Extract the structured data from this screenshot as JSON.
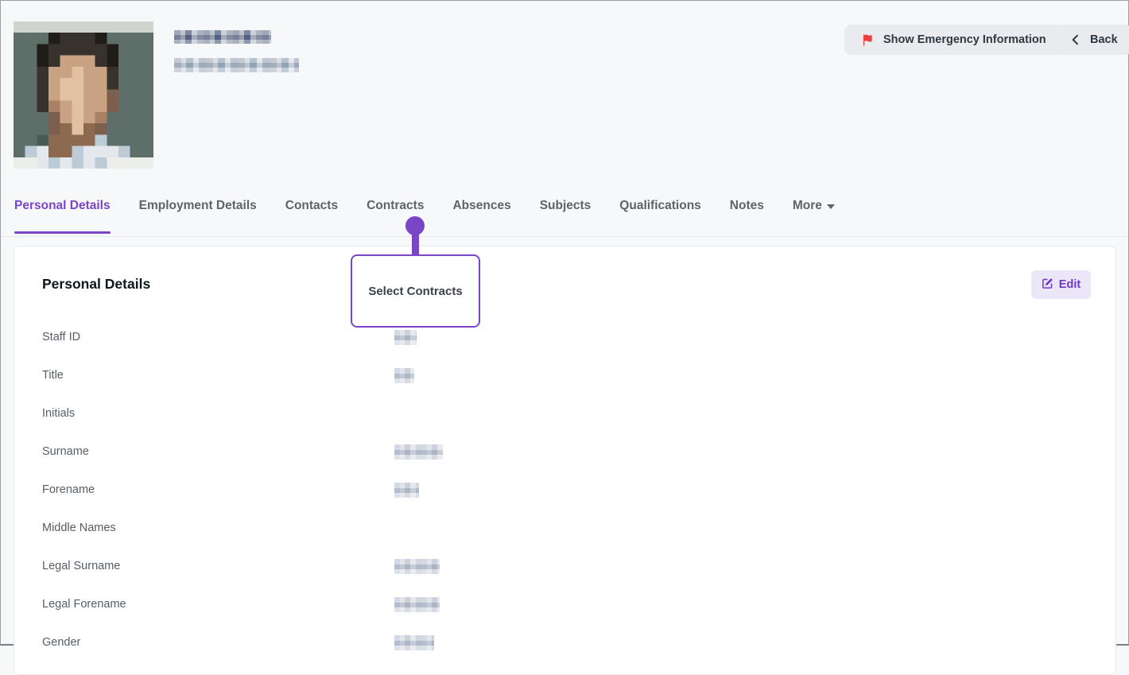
{
  "header": {
    "profile": {
      "photo": {
        "alt": "staff-profile-photo-pixelated",
        "palette": {
          "L": "#cfd4cf",
          "B": "#5d6f68",
          "T": "#4a5b57",
          "D": "#37322b",
          "d": "#201d19",
          "S": "#c9a183",
          "s": "#e2c0a2",
          "m": "#ab8166",
          "h": "#7c5f4c",
          "N": "#8d6950",
          "C": "#bccbd6",
          "c": "#e2e8ec",
          "W": "#eceeec"
        },
        "rows": [
          "LLLLLLLLLLLL",
          "BBBdDDDdBBBB",
          "BBdDDDDDdBBB",
          "BBdDSSSDdBBB",
          "BBDSSsSSDBBB",
          "BBDSssSSDBBB",
          "BBDSssSShBBB",
          "BBDmSsSShBBB",
          "BBBhSsSmBBBB",
          "BBBhNsNhBBBB",
          "BBTNNNNCBBBB",
          "BCcNNCcccCBB",
          "WWcCcCcCWWWW"
        ]
      }
    },
    "buttons": {
      "emergency": {
        "label": "Show Emergency Information",
        "icon": "flag",
        "icon_color": "#e8413d"
      },
      "back": {
        "label": "Back",
        "icon": "chevron-left"
      }
    }
  },
  "tabs": {
    "items": [
      {
        "label": "Personal Details",
        "active": true
      },
      {
        "label": "Employment Details",
        "active": false
      },
      {
        "label": "Contacts",
        "active": false
      },
      {
        "label": "Contracts",
        "active": false
      },
      {
        "label": "Absences",
        "active": false
      },
      {
        "label": "Subjects",
        "active": false
      },
      {
        "label": "Qualifications",
        "active": false
      },
      {
        "label": "Notes",
        "active": false
      },
      {
        "label": "More",
        "active": false,
        "has_dropdown": true
      }
    ]
  },
  "callout": {
    "label": "Select Contracts",
    "target_tab": "Contracts",
    "accent_color": "#7b45c7"
  },
  "panel": {
    "title": "Personal Details",
    "edit_button": {
      "label": "Edit",
      "icon": "edit-pencil"
    },
    "fields": [
      {
        "label": "Staff ID",
        "value_redacted": true
      },
      {
        "label": "Title",
        "value_redacted": true
      },
      {
        "label": "Initials",
        "value_redacted": false
      },
      {
        "label": "Surname",
        "value_redacted": true
      },
      {
        "label": "Forename",
        "value_redacted": true
      },
      {
        "label": "Middle Names",
        "value_redacted": false
      },
      {
        "label": "Legal Surname",
        "value_redacted": true
      },
      {
        "label": "Legal Forename",
        "value_redacted": true
      },
      {
        "label": "Gender",
        "value_redacted": true
      }
    ]
  },
  "colors": {
    "accent_purple": "#7b45c7",
    "flag_red": "#e8413d",
    "page_background": "#f7f8f9",
    "button_gray": "#e9ebee"
  }
}
